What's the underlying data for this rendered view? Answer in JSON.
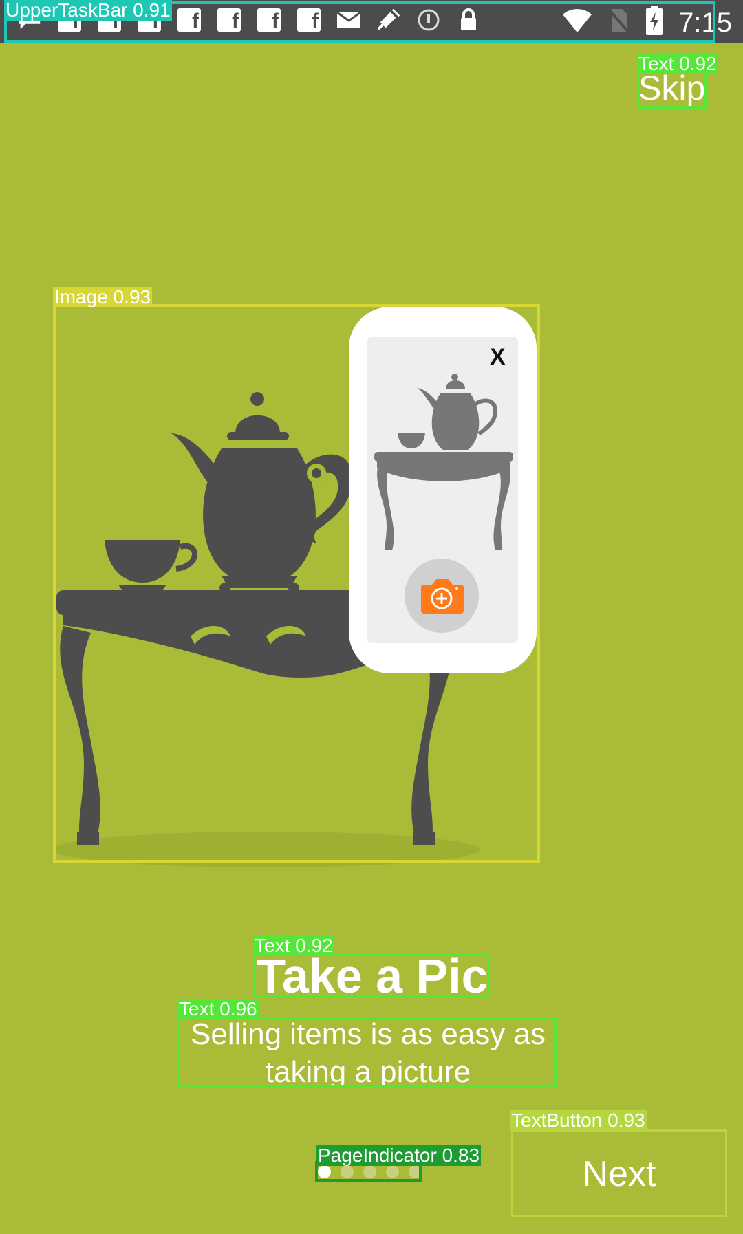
{
  "status_bar": {
    "time": "7:15",
    "notification_icons": [
      "messenger-icon",
      "facebook-icon",
      "facebook-icon",
      "facebook-icon",
      "facebook-icon",
      "facebook-icon",
      "facebook-icon",
      "facebook-icon",
      "mail-icon",
      "fake-gps-icon",
      "sync-icon",
      "lock-icon"
    ],
    "system_icons": [
      "wifi-icon",
      "no-sim-icon",
      "battery-charging-icon"
    ]
  },
  "header": {
    "skip_label": "Skip"
  },
  "card": {
    "close_label": "X"
  },
  "onboarding": {
    "title": "Take a Pic",
    "subtitle": "Selling items is as easy as taking a picture"
  },
  "pager": {
    "count": 5,
    "active_index": 0
  },
  "footer": {
    "next_label": "Next"
  },
  "detections": {
    "upper_task_bar": "UpperTaskBar 0.91",
    "skip_text": "Text 0.92",
    "image": "Image 0.93",
    "title_text": "Text 0.92",
    "subtitle_text": "Text 0.96",
    "page_indicator": "PageIndicator 0.83",
    "next_button": "TextButton 0.93"
  },
  "colors": {
    "background": "#a9bb37",
    "status_bar": "#4c4c4c",
    "silhouette": "#4d4d4d",
    "camera_orange": "#ff7a1a",
    "det_cyan": "#1dc7b4",
    "det_green": "#55e63a",
    "det_yellow": "#d6d636",
    "det_darkgreen": "#1f9b33"
  }
}
